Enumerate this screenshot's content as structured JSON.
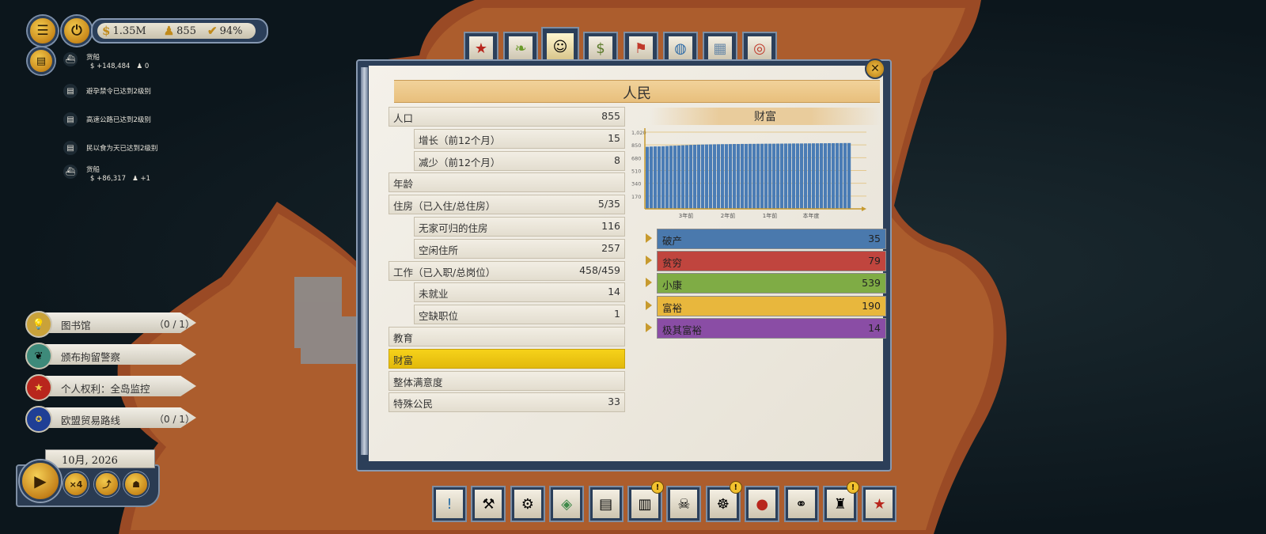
{
  "hud": {
    "money": "1.35M",
    "population": "855",
    "approval": "94%"
  },
  "feed": [
    {
      "title": "货船",
      "money": "+148,484",
      "people": "0"
    },
    {
      "title": "避孕禁令已达到2级别"
    },
    {
      "title": "高速公路已达到2级别"
    },
    {
      "title": "民以食为天已达到2级别"
    },
    {
      "title": "货船",
      "money": "+86,317",
      "people": "+1"
    }
  ],
  "policies": [
    {
      "label": "图书馆",
      "count": "（0 / 1）",
      "icon": "bulb-icon"
    },
    {
      "label": "颁布拘留警察",
      "count": "",
      "icon": "leaf-icon"
    },
    {
      "label": "个人权利：全岛监控",
      "count": "",
      "icon": "star-icon"
    },
    {
      "label": "欧盟贸易路线",
      "count": "（0 / 1）",
      "icon": "eu-icon"
    }
  ],
  "time": {
    "date": "10月, 2026",
    "speed": "×4"
  },
  "panel": {
    "title": "人民",
    "stats": [
      {
        "label": "人口",
        "value": "855"
      },
      {
        "label": "增长（前12个月）",
        "value": "15"
      },
      {
        "label": "减少（前12个月）",
        "value": "8"
      },
      {
        "label": "年龄",
        "value": ""
      },
      {
        "label": "住房（已入住/总住房）",
        "value": "5/35"
      },
      {
        "label": "无家可归的住房",
        "value": "116"
      },
      {
        "label": "空闲住所",
        "value": "257"
      },
      {
        "label": "工作（已入职/总岗位）",
        "value": "458/459"
      },
      {
        "label": "未就业",
        "value": "14"
      },
      {
        "label": "空缺职位",
        "value": "1"
      },
      {
        "label": "教育",
        "value": ""
      },
      {
        "label": "财富",
        "value": ""
      },
      {
        "label": "整体满意度",
        "value": ""
      },
      {
        "label": "特殊公民",
        "value": "33"
      }
    ],
    "chart_title": "财富",
    "wealth": [
      {
        "label": "破产",
        "value": "35",
        "color": "#4a79ad"
      },
      {
        "label": "贫穷",
        "value": "79",
        "color": "#c0453e"
      },
      {
        "label": "小康",
        "value": "539",
        "color": "#7fac45"
      },
      {
        "label": "富裕",
        "value": "190",
        "color": "#e8b73d"
      },
      {
        "label": "极其富裕",
        "value": "14",
        "color": "#8a4da5"
      }
    ]
  },
  "chart_data": {
    "type": "bar",
    "y_ticks": [
      "1,020",
      "850",
      "680",
      "510",
      "340",
      "170"
    ],
    "ylim": [
      0,
      1020
    ],
    "x_ticks": [
      "3年前",
      "2年前",
      "1年前",
      "本年度"
    ],
    "values": [
      825,
      828,
      830,
      830,
      832,
      835,
      838,
      840,
      842,
      845,
      847,
      850,
      852,
      854,
      855,
      856,
      857,
      858,
      859,
      860,
      860,
      861,
      862,
      862,
      863,
      863,
      864,
      864,
      865,
      865,
      866,
      866,
      866,
      867,
      867,
      868,
      868,
      869,
      869,
      869,
      870,
      870,
      871,
      871,
      872,
      872,
      873,
      873,
      874,
      874,
      875,
      875
    ],
    "bar_color": "#4a7cb5"
  },
  "toolbar": [
    "alert-icon",
    "hammer-icon",
    "gear-book-icon",
    "map-icon",
    "scroll-icon",
    "books-icon",
    "pirate-flag-icon",
    "wheel-icon",
    "red-seal-icon",
    "handshake-icon",
    "suit-icon",
    "star-badge-icon"
  ]
}
